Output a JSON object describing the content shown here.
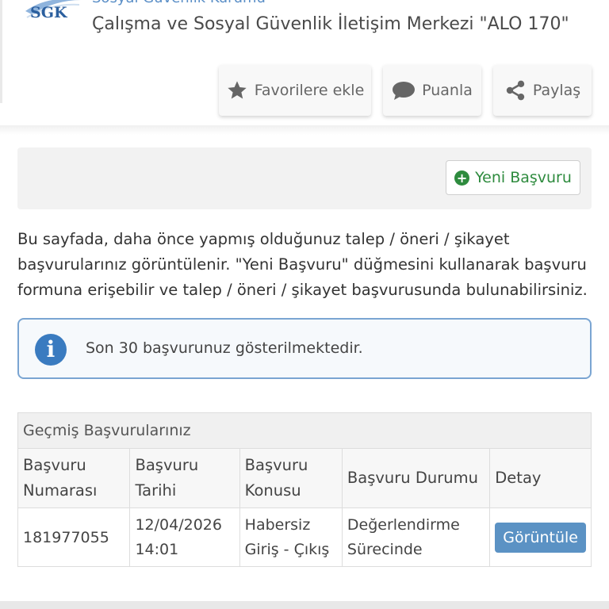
{
  "header": {
    "logo_text": "SGK",
    "org_name": "Sosyal Güvenlik Kurumu",
    "title": "Çalışma ve Sosyal Güvenlik İletişim Merkezi \"ALO 170\""
  },
  "actions": {
    "favorite_label": "Favorilere ekle",
    "rate_label": "Puanla",
    "share_label": "Paylaş"
  },
  "toolbar": {
    "new_application_label": "Yeni Başvuru"
  },
  "intro": {
    "text": "Bu sayfada, daha önce yapmış olduğunuz talep / öneri / şikayet başvurularınız görüntülenir. \"Yeni Başvuru\" düğmesini kullanarak başvuru formuna erişebilir ve talep / öneri / şikayet başvurusunda bulunabilirsiniz."
  },
  "alert": {
    "message": "Son 30 başvurunuz gösterilmektedir."
  },
  "history": {
    "title": "Geçmiş Başvurularınız",
    "columns": [
      "Başvuru Numarası",
      "Başvuru Tarihi",
      "Başvuru Konusu",
      "Başvuru Durumu",
      "Detay"
    ],
    "rows": [
      {
        "number": "181977055",
        "date": "12/04/2026 14:01",
        "subject": "Habersiz Giriş - Çıkış",
        "status": "Değerlendirme Sürecinde",
        "action": "Görüntüle"
      }
    ]
  },
  "colors": {
    "accent_green": "#2e8b3e",
    "info_blue": "#3a7bc0",
    "button_blue": "#5b92c4"
  }
}
